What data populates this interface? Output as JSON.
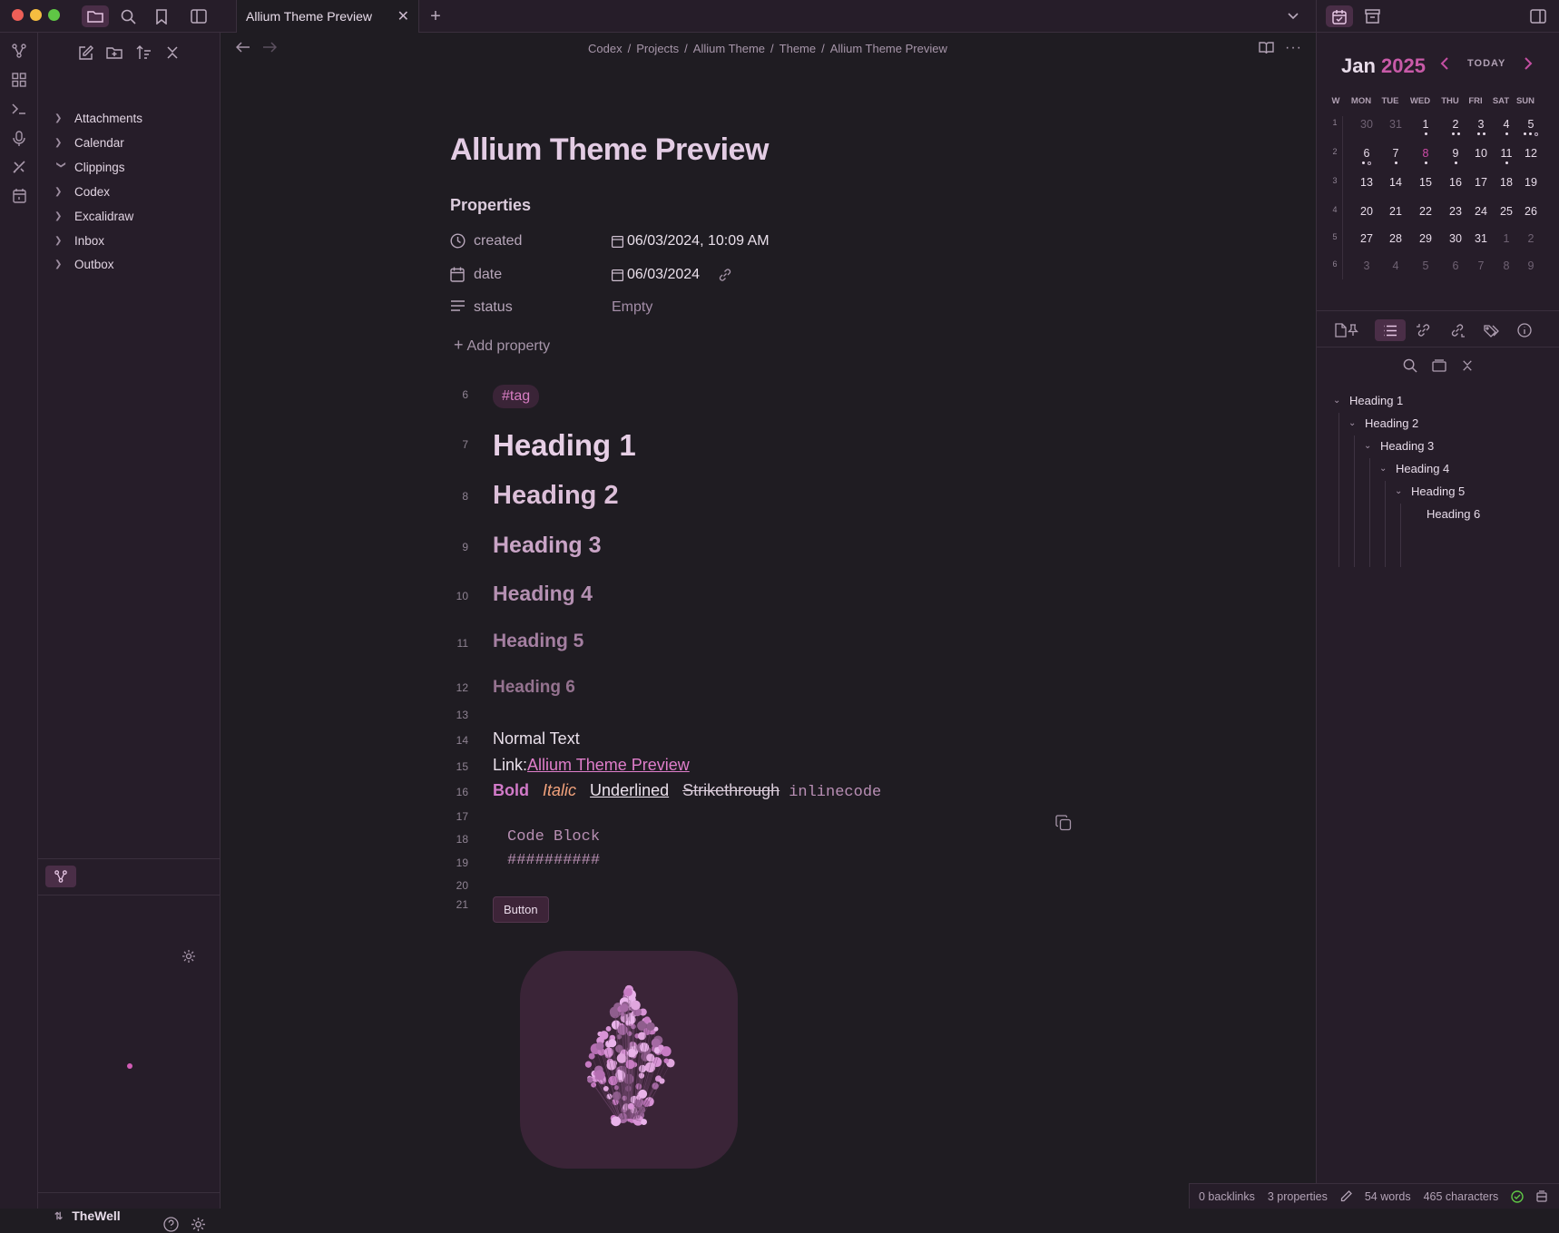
{
  "tab": {
    "title": "Allium Theme Preview"
  },
  "sidebar": {
    "folders": [
      "Attachments",
      "Calendar",
      "Clippings",
      "Codex",
      "Excalidraw",
      "Inbox",
      "Outbox"
    ],
    "vault_name": "TheWell"
  },
  "breadcrumb": [
    "Codex",
    "Projects",
    "Allium Theme",
    "Theme",
    "Allium Theme Preview"
  ],
  "note": {
    "title": "Allium Theme Preview",
    "properties_heading": "Properties",
    "properties": [
      {
        "icon": "clock-icon",
        "key": "created",
        "value": "06/03/2024, 10:09 AM"
      },
      {
        "icon": "calendar-icon",
        "key": "date",
        "value": "06/03/2024"
      },
      {
        "icon": "list-icon",
        "key": "status",
        "value": "Empty"
      }
    ],
    "add_property": "Add property",
    "line_numbers": [
      "6",
      "7",
      "8",
      "9",
      "10",
      "11",
      "12",
      "13",
      "14",
      "15",
      "16",
      "17",
      "18",
      "19",
      "20",
      "21"
    ],
    "tag": "#tag",
    "headings": [
      "Heading 1",
      "Heading 2",
      "Heading 3",
      "Heading 4",
      "Heading 5",
      "Heading 6"
    ],
    "normal_text": "Normal Text",
    "link_prefix": "Link:",
    "link_text": "Allium Theme Preview",
    "bold": "Bold",
    "italic": "Italic",
    "underlined": "Underlined",
    "strikethrough": "Strikethrough",
    "inline_code": "inlinecode",
    "code_lines": [
      "Code Block",
      "##########"
    ],
    "button_label": "Button"
  },
  "status_bar": {
    "backlinks": "0 backlinks",
    "properties": "3 properties",
    "words": "54 words",
    "characters": "465 characters"
  },
  "calendar": {
    "month": "Jan",
    "year": "2025",
    "today_label": "TODAY",
    "headers": [
      "W",
      "MON",
      "TUE",
      "WED",
      "THU",
      "FRI",
      "SAT",
      "SUN"
    ],
    "weeks": [
      {
        "wk": "1",
        "days": [
          "30",
          "31",
          "1",
          "2",
          "3",
          "4",
          "5"
        ]
      },
      {
        "wk": "2",
        "days": [
          "6",
          "7",
          "8",
          "9",
          "10",
          "11",
          "12"
        ]
      },
      {
        "wk": "3",
        "days": [
          "13",
          "14",
          "15",
          "16",
          "17",
          "18",
          "19"
        ]
      },
      {
        "wk": "4",
        "days": [
          "20",
          "21",
          "22",
          "23",
          "24",
          "25",
          "26"
        ]
      },
      {
        "wk": "5",
        "days": [
          "27",
          "28",
          "29",
          "30",
          "31",
          "1",
          "2"
        ]
      },
      {
        "wk": "6",
        "days": [
          "3",
          "4",
          "5",
          "6",
          "7",
          "8",
          "9"
        ]
      }
    ]
  },
  "outline": [
    "Heading 1",
    "Heading 2",
    "Heading 3",
    "Heading 4",
    "Heading 5",
    "Heading 6"
  ],
  "colors": {
    "accent": "#c85aa8",
    "background": "#1f1c22",
    "sidebar": "#261d29"
  }
}
